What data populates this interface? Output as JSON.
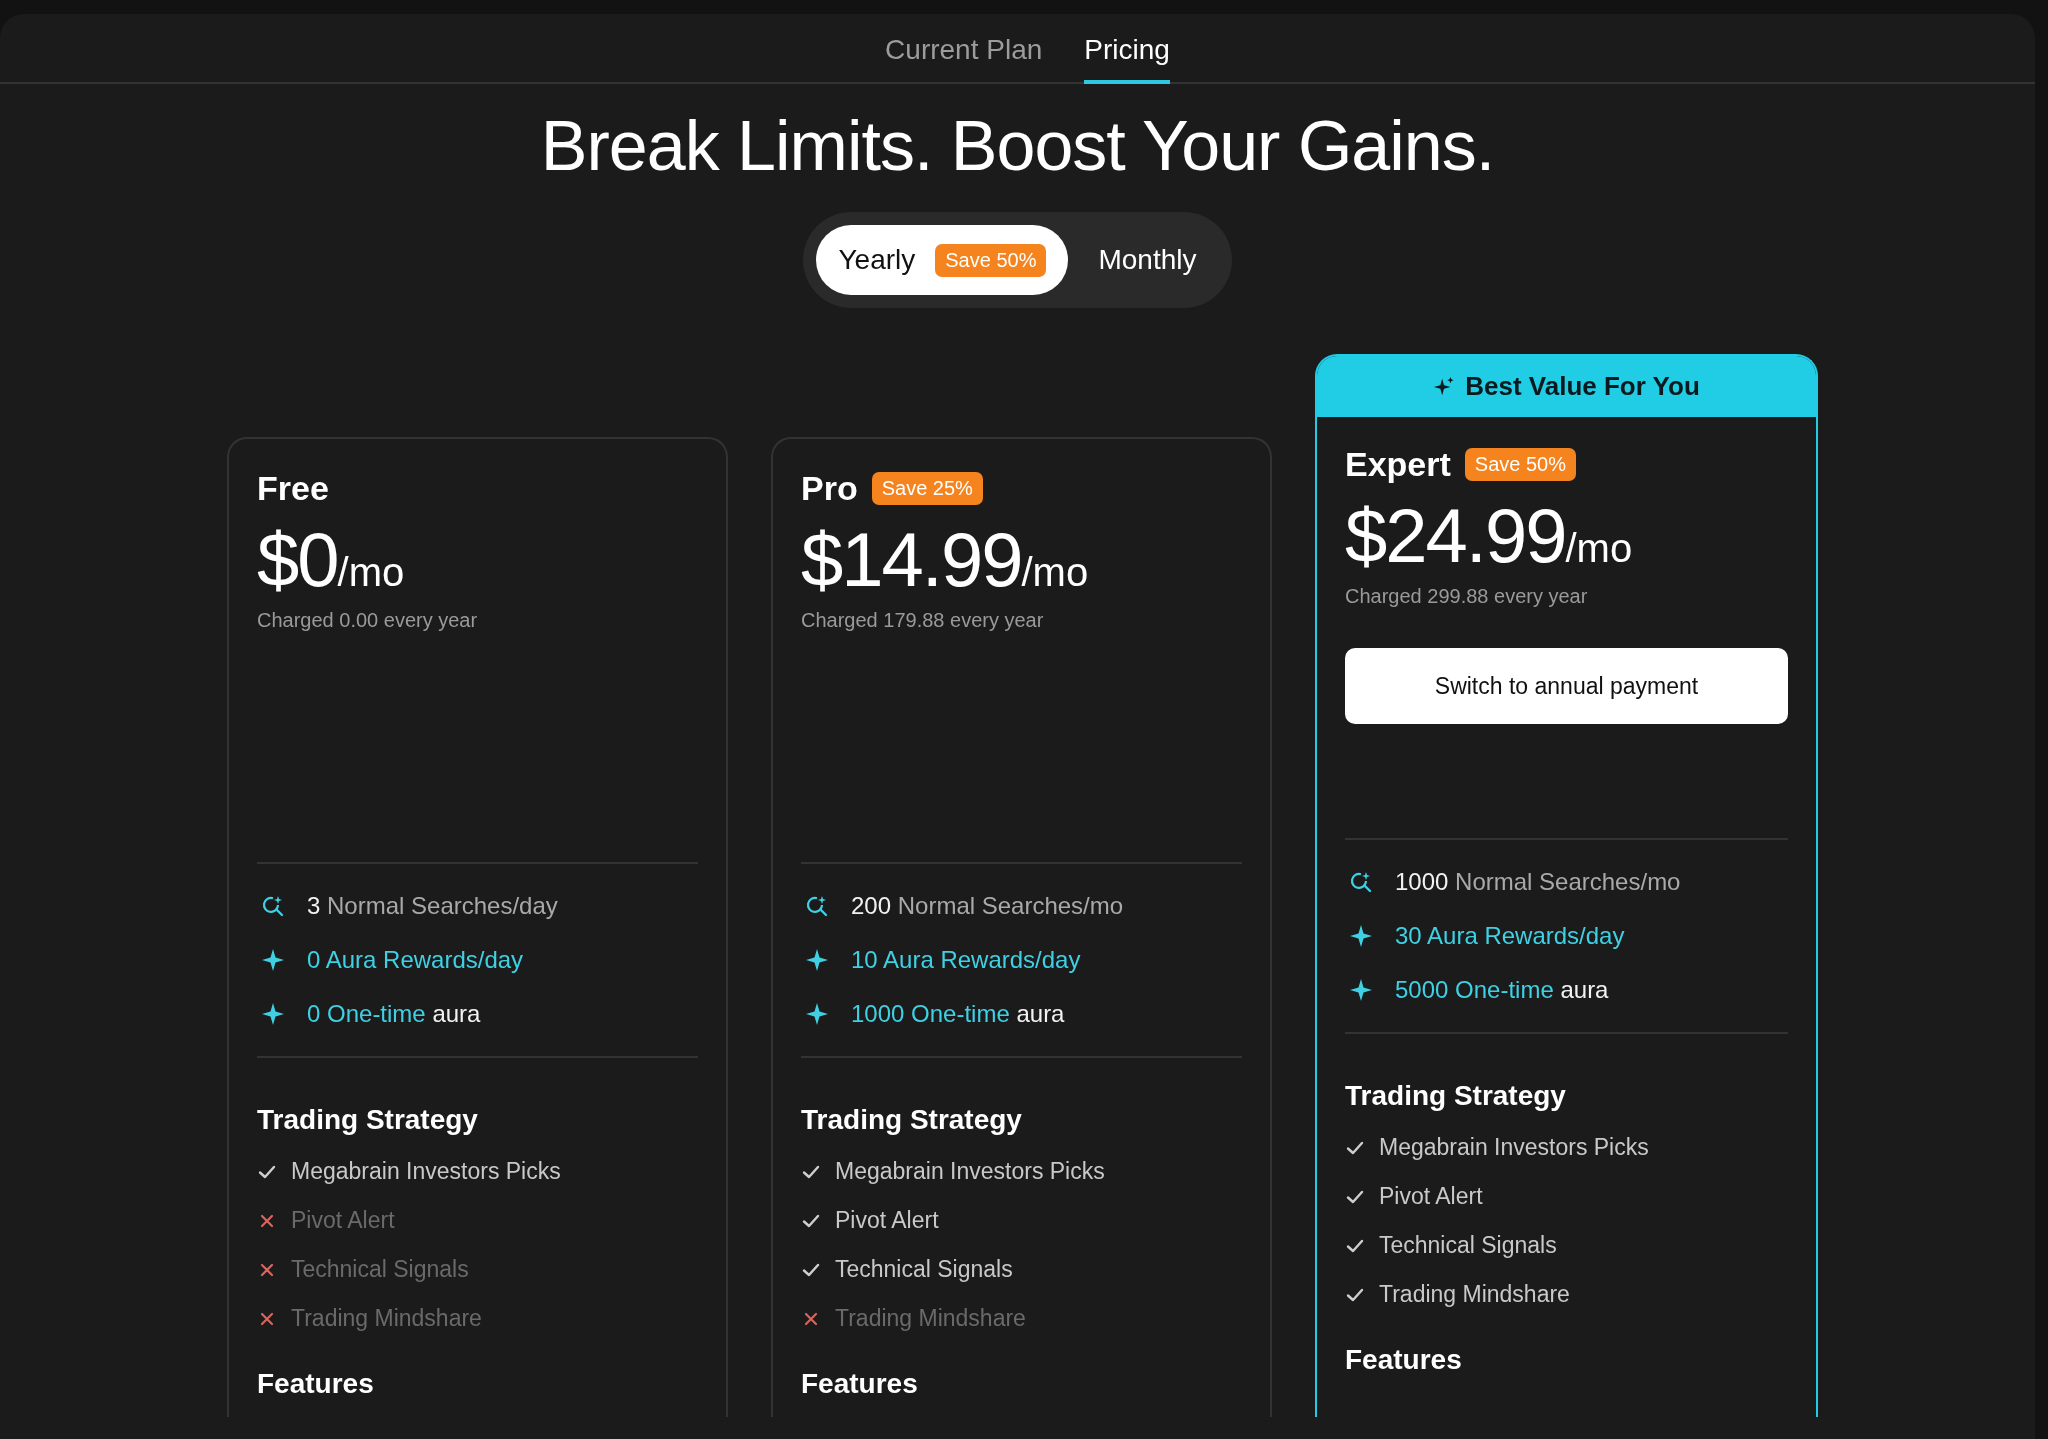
{
  "tabs": [
    {
      "label": "Current Plan",
      "selected": false
    },
    {
      "label": "Pricing",
      "selected": true
    }
  ],
  "headline": "Break Limits. Boost Your Gains.",
  "billing_toggle": [
    {
      "label": "Yearly",
      "badge": "Save 50%",
      "selected": true
    },
    {
      "label": "Monthly",
      "selected": false
    }
  ],
  "plans": [
    {
      "name": "Free",
      "price": "$0",
      "period": "/mo",
      "charged": "Charged 0.00 every year",
      "highlighted": false,
      "stats": [
        {
          "kind": "search",
          "parts": [
            {
              "text": "3",
              "color": "#f2f2f2"
            },
            {
              "text": "Normal Searches/day",
              "color": "#a9a9a9"
            }
          ]
        },
        {
          "kind": "aura",
          "parts": [
            {
              "text": "0 Aura Rewards/day",
              "color": "#3fd0e4"
            }
          ]
        },
        {
          "kind": "aura",
          "parts": [
            {
              "text": "0 One-time",
              "color": "#3fd0e4"
            },
            {
              "text": "aura",
              "color": "#f2f2f2"
            }
          ]
        }
      ],
      "strategy_title": "Trading Strategy",
      "strategy": [
        {
          "label": "Megabrain Investors Picks",
          "included": true
        },
        {
          "label": "Pivot Alert",
          "included": false
        },
        {
          "label": "Technical Signals",
          "included": false
        },
        {
          "label": "Trading Mindshare",
          "included": false
        }
      ],
      "features_title": "Features"
    },
    {
      "name": "Pro",
      "badge": "Save 25%",
      "price": "$14.99",
      "period": "/mo",
      "charged": "Charged 179.88 every year",
      "highlighted": false,
      "stats": [
        {
          "kind": "search",
          "parts": [
            {
              "text": "200",
              "color": "#f2f2f2"
            },
            {
              "text": "Normal Searches/mo",
              "color": "#a9a9a9"
            }
          ]
        },
        {
          "kind": "aura",
          "parts": [
            {
              "text": "10 Aura Rewards/day",
              "color": "#3fd0e4"
            }
          ]
        },
        {
          "kind": "aura",
          "parts": [
            {
              "text": "1000 One-time",
              "color": "#3fd0e4"
            },
            {
              "text": "aura",
              "color": "#f2f2f2"
            }
          ]
        }
      ],
      "strategy_title": "Trading Strategy",
      "strategy": [
        {
          "label": "Megabrain Investors Picks",
          "included": true
        },
        {
          "label": "Pivot Alert",
          "included": true
        },
        {
          "label": "Technical Signals",
          "included": true
        },
        {
          "label": "Trading Mindshare",
          "included": false
        }
      ],
      "features_title": "Features"
    },
    {
      "name": "Expert",
      "badge": "Save 50%",
      "price": "$24.99",
      "period": "/mo",
      "charged": "Charged 299.88 every year",
      "highlighted": true,
      "banner": "Best Value For You",
      "button": "Switch to annual payment",
      "stats": [
        {
          "kind": "search",
          "parts": [
            {
              "text": "1000",
              "color": "#f2f2f2"
            },
            {
              "text": "Normal Searches/mo",
              "color": "#a9a9a9"
            }
          ]
        },
        {
          "kind": "aura",
          "parts": [
            {
              "text": "30 Aura Rewards/day",
              "color": "#3fd0e4"
            }
          ]
        },
        {
          "kind": "aura",
          "parts": [
            {
              "text": "5000 One-time",
              "color": "#3fd0e4"
            },
            {
              "text": "aura",
              "color": "#f2f2f2"
            }
          ]
        }
      ],
      "strategy_title": "Trading Strategy",
      "strategy": [
        {
          "label": "Megabrain Investors Picks",
          "included": true
        },
        {
          "label": "Pivot Alert",
          "included": true
        },
        {
          "label": "Technical Signals",
          "included": true
        },
        {
          "label": "Trading Mindshare",
          "included": true
        }
      ],
      "features_title": "Features"
    }
  ]
}
